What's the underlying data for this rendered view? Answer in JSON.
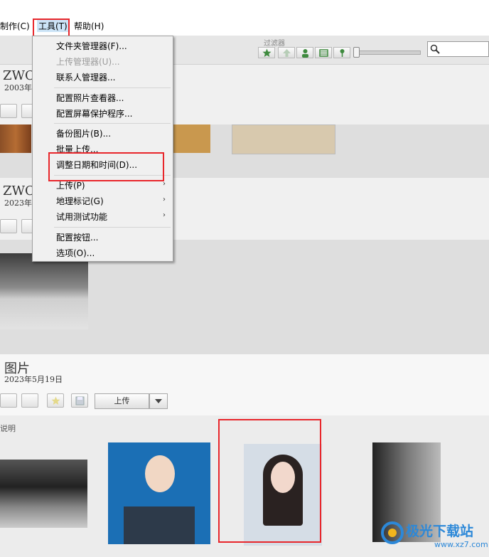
{
  "menubar": {
    "items": [
      "制作(C)",
      "工具(T)",
      "帮助(H)"
    ]
  },
  "toolbar": {
    "filter_label": "过滤器",
    "filters": [
      "star-icon",
      "upload-icon",
      "person-icon",
      "film-icon",
      "pin-icon"
    ]
  },
  "sections": [
    {
      "title": "ZWC",
      "date": "2003年"
    },
    {
      "title": "ZWC",
      "date": "2023年"
    }
  ],
  "tools_menu": {
    "items": [
      {
        "label": "文件夹管理器(F)...",
        "disabled": false
      },
      {
        "label": "上传管理器(U)...",
        "disabled": true
      },
      {
        "label": "联系人管理器...",
        "disabled": false
      },
      {
        "label": "配置照片查看器...",
        "disabled": false
      },
      {
        "label": "配置屏幕保护程序...",
        "disabled": false
      },
      {
        "label": "备份图片(B)...",
        "disabled": false
      },
      {
        "label": "批量上传...",
        "disabled": false
      },
      {
        "label": "调整日期和时间(D)...",
        "disabled": false
      },
      {
        "label": "上传(P)",
        "disabled": false,
        "submenu": true
      },
      {
        "label": "地理标记(G)",
        "disabled": false,
        "submenu": true
      },
      {
        "label": "试用测试功能",
        "disabled": false,
        "submenu": true
      },
      {
        "label": "配置按钮...",
        "disabled": false
      },
      {
        "label": "选项(O)...",
        "disabled": false
      }
    ]
  },
  "pictures": {
    "title": "图片",
    "date": "2023年5月19日",
    "upload_label": "上传",
    "caption_hint": "说明"
  },
  "watermark": {
    "text": "极光下载站",
    "url": "www.xz7.com"
  },
  "colors": {
    "highlight": "#e8262b",
    "menu_bg": "#f0f0f0",
    "section_bg": "#dedede"
  }
}
